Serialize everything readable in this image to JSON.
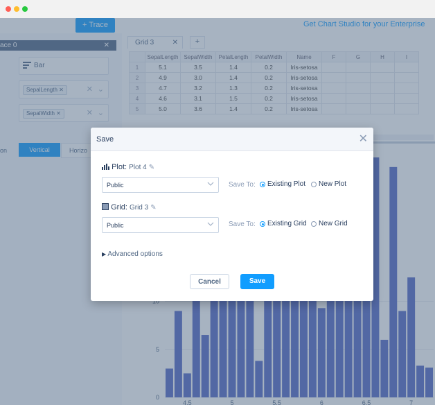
{
  "window": {
    "dots": [
      "#ff5f56",
      "#ffbd2e",
      "#27c93f"
    ]
  },
  "topbar": {
    "trace_button": "+ Trace",
    "enterprise_link": "Get Chart Studio for your Enterprise"
  },
  "left_panel": {
    "header": "ace 0",
    "type_value": "Bar",
    "x_chip": "SepalLength",
    "y_chip": "SepalWidth",
    "orientation_label": "on",
    "orientation_options": [
      "Vertical",
      "Horizo"
    ]
  },
  "grid": {
    "tab_label": "Grid 3",
    "columns": [
      "SepalLength",
      "SepalWidth",
      "PetalLength",
      "PetalWidth",
      "Name",
      "F",
      "G",
      "H",
      "I"
    ],
    "rows": [
      {
        "n": "1",
        "vals": [
          "5.1",
          "3.5",
          "1.4",
          "0.2",
          "Iris-setosa"
        ]
      },
      {
        "n": "2",
        "vals": [
          "4.9",
          "3.0",
          "1.4",
          "0.2",
          "Iris-setosa"
        ]
      },
      {
        "n": "3",
        "vals": [
          "4.7",
          "3.2",
          "1.3",
          "0.2",
          "Iris-setosa"
        ]
      },
      {
        "n": "4",
        "vals": [
          "4.6",
          "3.1",
          "1.5",
          "0.2",
          "Iris-setosa"
        ]
      },
      {
        "n": "5",
        "vals": [
          "5.0",
          "3.6",
          "1.4",
          "0.2",
          "Iris-setosa"
        ]
      }
    ]
  },
  "chart_data": {
    "type": "bar",
    "x": [
      4.3,
      4.4,
      4.5,
      4.6,
      4.7,
      4.8,
      4.9,
      5.0,
      5.1,
      5.2,
      5.3,
      5.4,
      5.5,
      5.6,
      5.7,
      5.8,
      5.9,
      6.0,
      6.1,
      6.2,
      6.3,
      6.4,
      6.5,
      6.6,
      6.7,
      6.8,
      6.9,
      7.0,
      7.1,
      7.2
    ],
    "values": [
      3,
      9,
      2.5,
      25,
      6.5,
      25,
      25,
      25,
      25,
      25,
      3.8,
      25,
      25,
      25,
      25,
      25,
      25,
      9.3,
      25,
      25,
      25,
      25,
      25,
      25,
      6,
      24,
      9,
      12.5,
      3.3,
      3.1
    ],
    "xticks": [
      "4.5",
      "5",
      "5.5",
      "6",
      "6.5",
      "7"
    ],
    "yticks": [
      "0",
      "5",
      "10"
    ],
    "bar_color": "#5468c4"
  },
  "modal": {
    "title": "Save",
    "plot_label": "Plot:",
    "plot_name": "Plot 4",
    "plot_privacy": "Public",
    "save_to_label": "Save To:",
    "plot_option_existing": "Existing Plot",
    "plot_option_new": "New Plot",
    "grid_label": "Grid:",
    "grid_name": "Grid 3",
    "grid_privacy": "Public",
    "grid_option_existing": "Existing Grid",
    "grid_option_new": "New Grid",
    "advanced": "Advanced options",
    "cancel": "Cancel",
    "save": "Save"
  },
  "colors": {
    "accent": "#119dff",
    "header_dark": "#506784"
  }
}
